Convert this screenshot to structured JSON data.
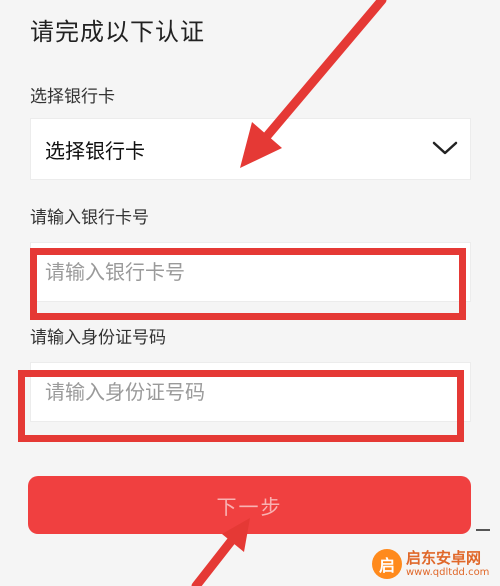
{
  "page": {
    "title": "请完成以下认证"
  },
  "bank": {
    "label": "选择银行卡",
    "selected_value": "选择银行卡",
    "chevron_icon": "chevron-down-icon"
  },
  "card": {
    "label": "请输入银行卡号",
    "placeholder": "请输入银行卡号",
    "value": ""
  },
  "id_number": {
    "label": "请输入身份证号码",
    "placeholder": "请输入身份证号码",
    "value": ""
  },
  "actions": {
    "next_label": "下一步"
  },
  "watermark": {
    "logo_char": "启",
    "name": "启东安卓网",
    "url": "www.qdltdd.com"
  },
  "colors": {
    "accent": "#f04040",
    "annotation": "#e53935",
    "background": "#f5f5f5"
  }
}
